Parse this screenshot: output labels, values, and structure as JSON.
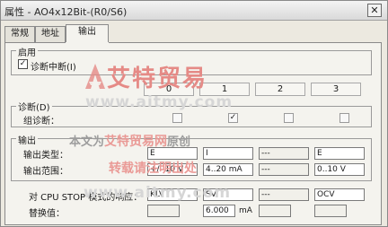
{
  "window": {
    "title": "属性 - AO4x12Bit-(R0/S6)",
    "close_glyph": "✕"
  },
  "tabs": [
    "常规",
    "地址",
    "输出"
  ],
  "enable_group": {
    "label": "启用",
    "diag_interrupt": "诊断中断(I)",
    "checked": true
  },
  "columns": [
    "0",
    "1",
    "2",
    "3"
  ],
  "diagnostics": {
    "label": "诊断(D)",
    "group_label": "组诊断：",
    "states": [
      false,
      true,
      false,
      false
    ]
  },
  "output": {
    "label": "输出",
    "type_label": "输出类型：",
    "range_label": "输出范围：",
    "types": [
      "E",
      "I",
      "---",
      "E"
    ],
    "ranges": [
      "+/- 10 V",
      "4..20 mA",
      "---",
      "0..10 V"
    ]
  },
  "cpu_stop": {
    "label": "对 CPU STOP 模式的响应：",
    "values": [
      "KLV",
      "SV",
      "---",
      "OCV"
    ]
  },
  "substitute": {
    "label": "替换值：",
    "values": [
      "",
      "6.000",
      "",
      ""
    ],
    "unit": "mA"
  },
  "watermark": {
    "brand": "艾特贸易",
    "url": "www.aitmy.com",
    "line1_prefix": "本文为",
    "line1_brand": "艾特贸易网",
    "line1_suffix": "原创",
    "line2": "转载请注明出处"
  },
  "colors": {
    "accent_red": "#e58a86"
  }
}
